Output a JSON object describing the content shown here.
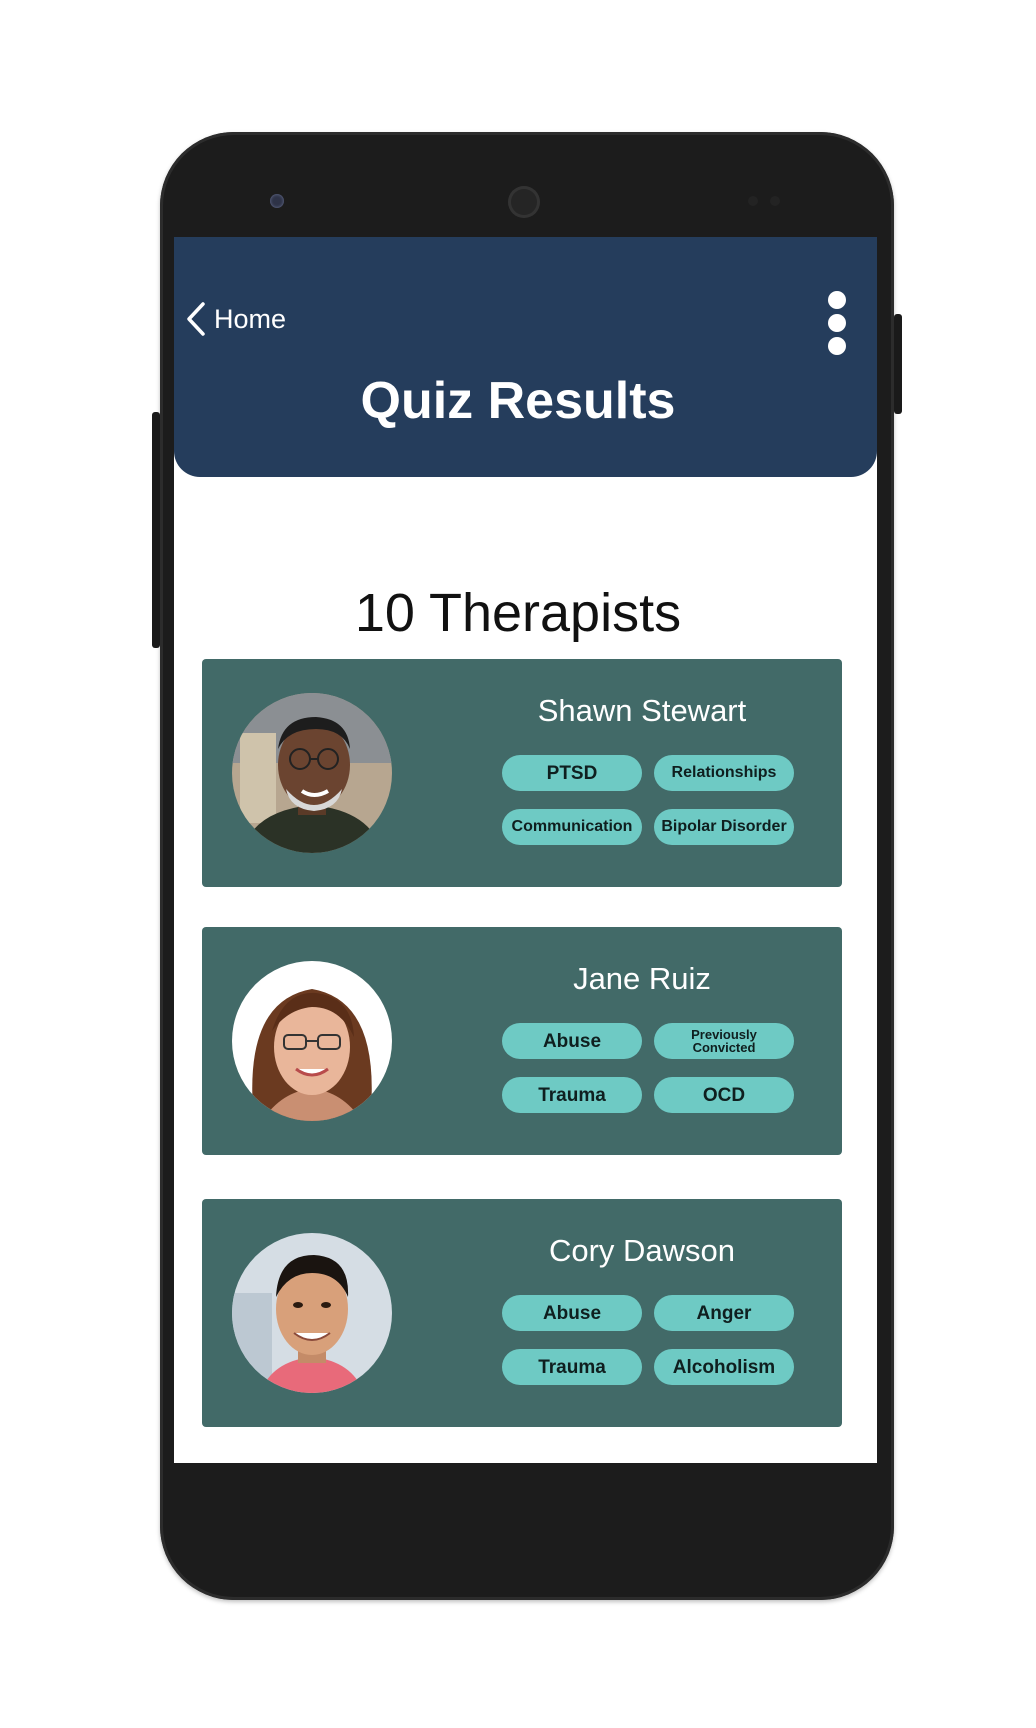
{
  "header": {
    "back_label": "Home",
    "title": "Quiz Results",
    "background_color": "#253d5c"
  },
  "summary": {
    "count_text": "10 Therapists"
  },
  "therapists": [
    {
      "name": "Shawn Stewart",
      "tags": [
        "PTSD",
        "Relationships",
        "Communication",
        "Bipolar Disorder"
      ]
    },
    {
      "name": "Jane Ruiz",
      "tags": [
        "Abuse",
        "Previously Convicted",
        "Trauma",
        "OCD"
      ]
    },
    {
      "name": "Cory Dawson",
      "tags": [
        "Abuse",
        "Anger",
        "Trauma",
        "Alcoholism"
      ]
    }
  ],
  "colors": {
    "card": "#426a68",
    "tag": "#6ecac4",
    "phone_body": "#1c1c1c"
  },
  "icons": [
    "chevron-left-icon",
    "more-vertical-icon"
  ]
}
